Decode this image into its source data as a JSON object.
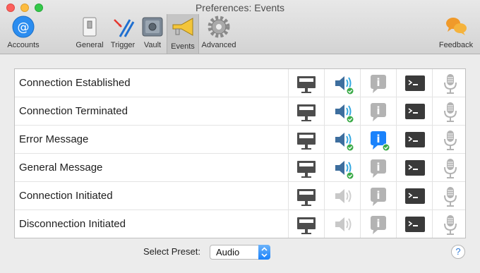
{
  "window": {
    "title": "Preferences: Events"
  },
  "toolbar": {
    "accounts": "Accounts",
    "general": "General",
    "trigger": "Trigger",
    "vault": "Vault",
    "events": "Events",
    "advanced": "Advanced",
    "feedback": "Feedback"
  },
  "events": [
    {
      "label": "Connection Established",
      "display": true,
      "sound": true,
      "notification": false,
      "terminal": true,
      "speak": false
    },
    {
      "label": "Connection Terminated",
      "display": true,
      "sound": true,
      "notification": false,
      "terminal": true,
      "speak": false
    },
    {
      "label": "Error Message",
      "display": true,
      "sound": true,
      "notification": true,
      "terminal": true,
      "speak": false
    },
    {
      "label": "General Message",
      "display": true,
      "sound": true,
      "notification": false,
      "terminal": true,
      "speak": false
    },
    {
      "label": "Connection Initiated",
      "display": true,
      "sound": false,
      "notification": false,
      "terminal": true,
      "speak": false
    },
    {
      "label": "Disconnection Initiated",
      "display": true,
      "sound": false,
      "notification": false,
      "terminal": true,
      "speak": false
    }
  ],
  "preset": {
    "label": "Select Preset:",
    "value": "Audio"
  },
  "help": {
    "symbol": "?"
  },
  "colors": {
    "accent": "#1a82fb",
    "check": "#3aaa47",
    "icon_dark": "#4d4d4d",
    "icon_light": "#b3b3b3"
  }
}
